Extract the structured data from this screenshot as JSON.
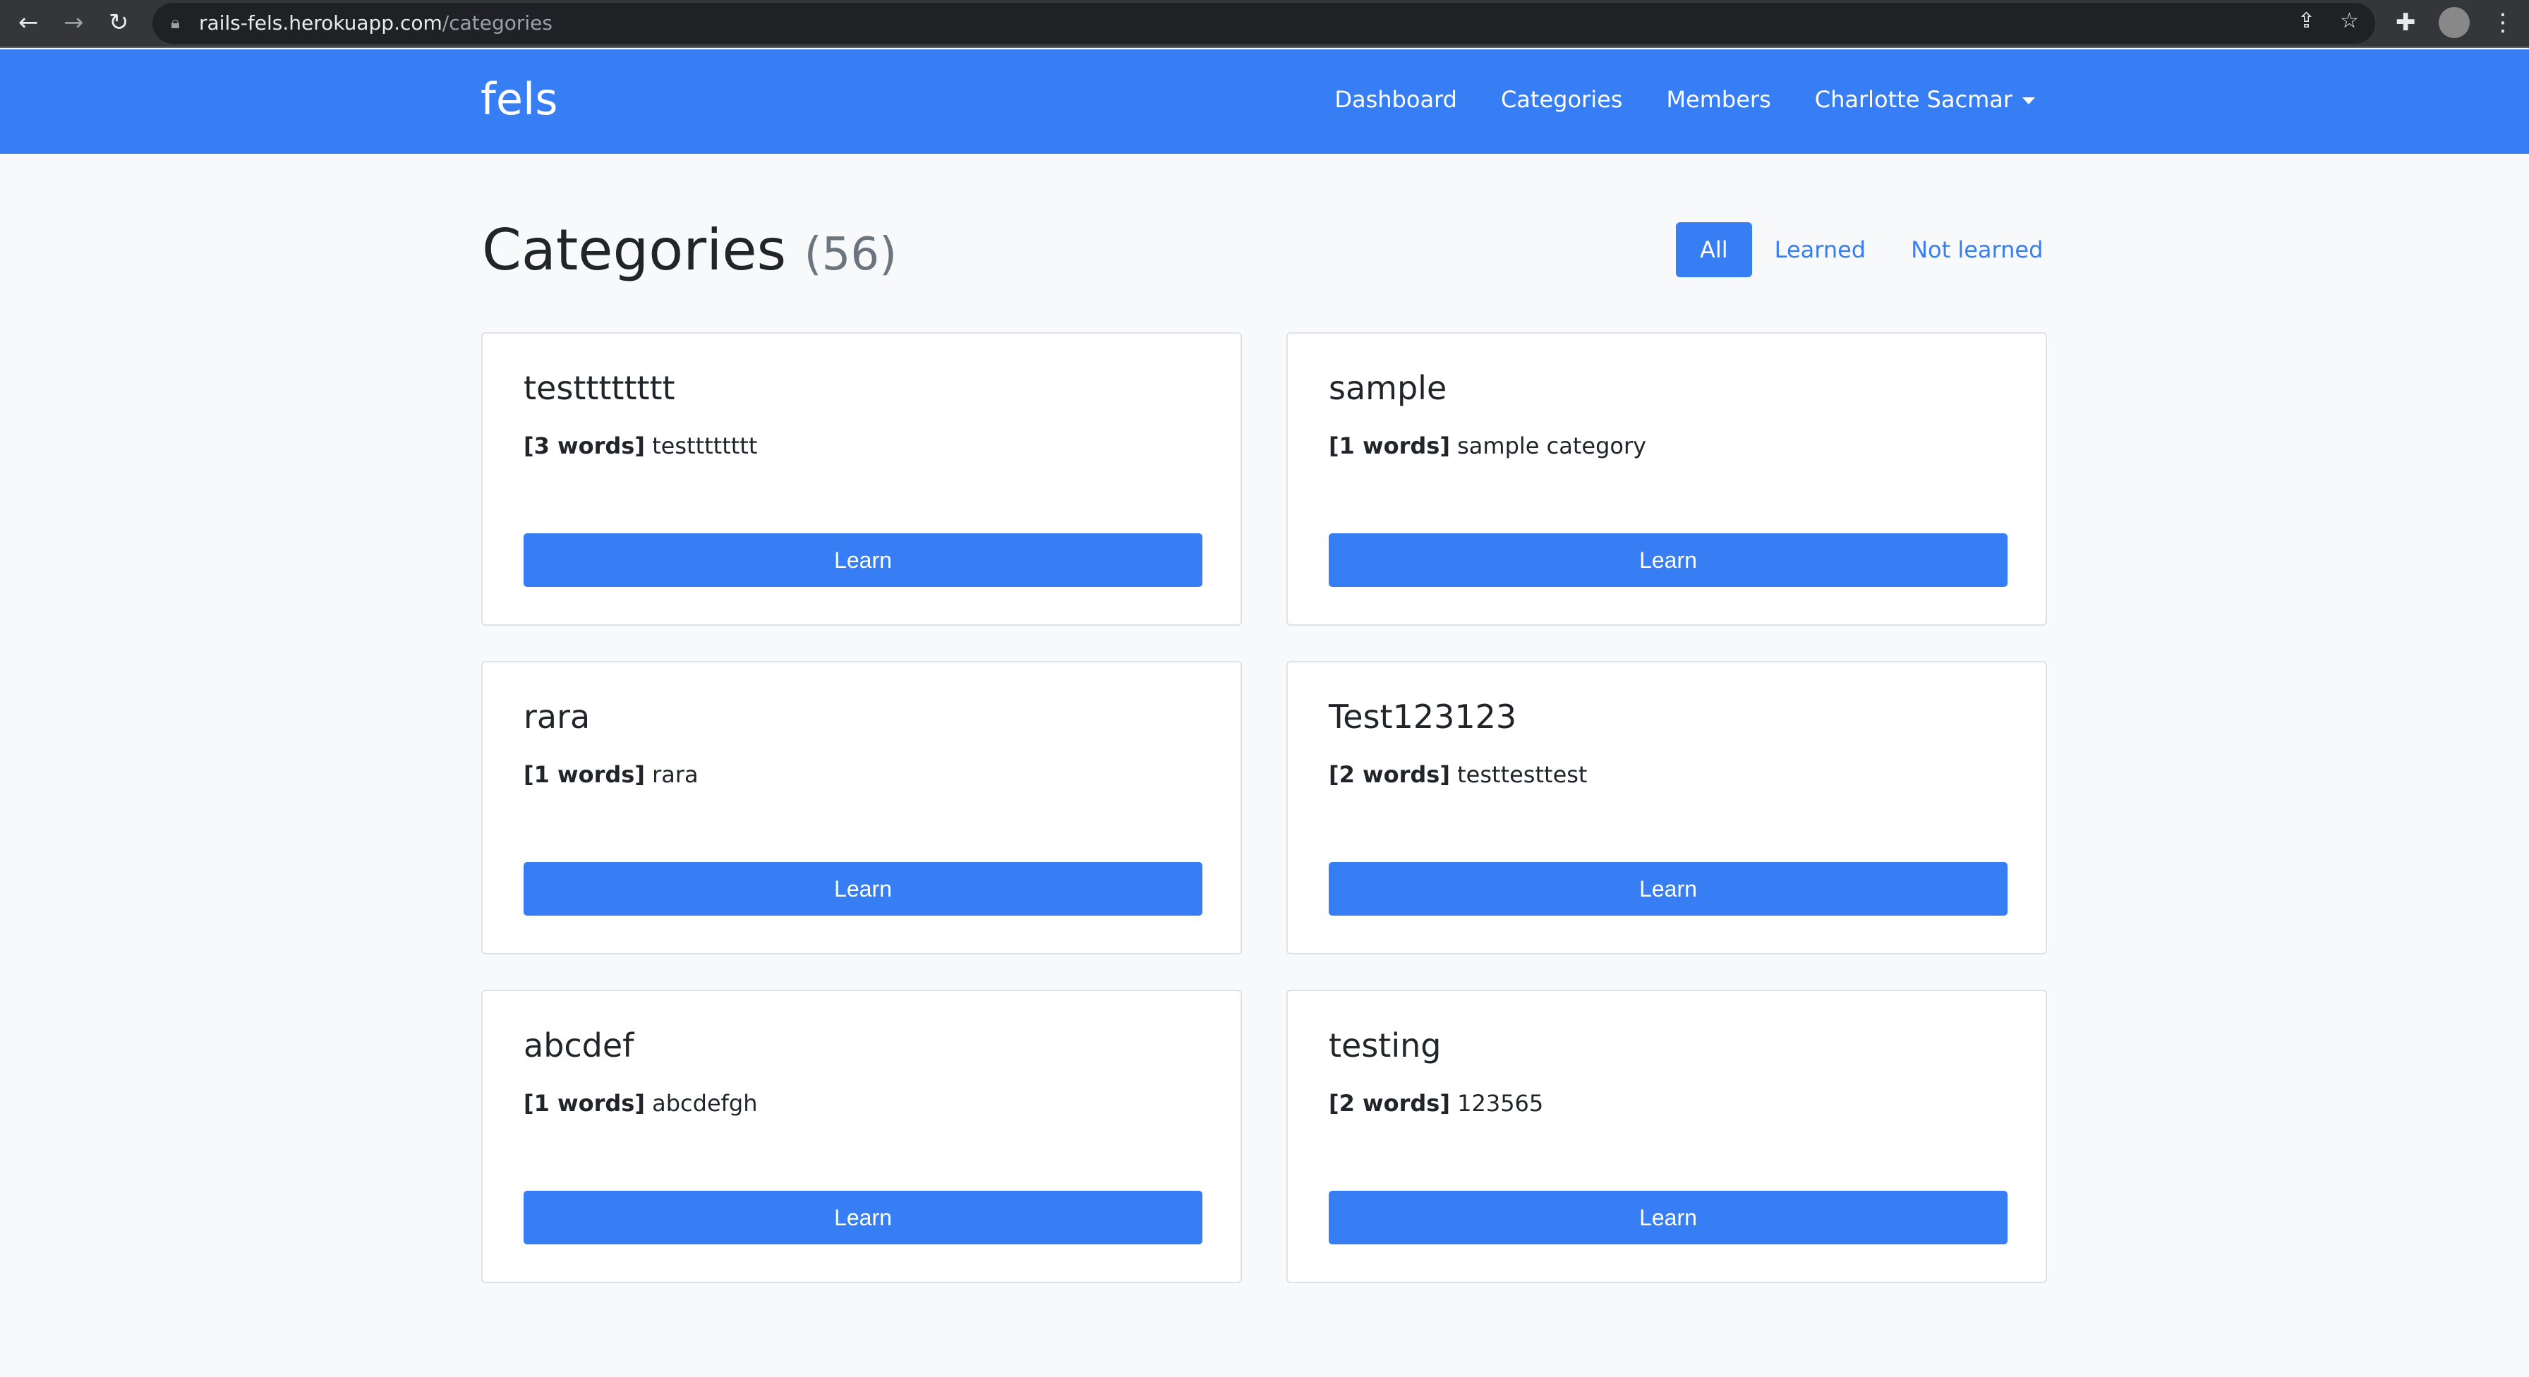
{
  "browser": {
    "url_host": "rails-fels.herokuapp.com",
    "url_path": "/categories"
  },
  "nav": {
    "brand": "fels",
    "links": [
      "Dashboard",
      "Categories",
      "Members"
    ],
    "user": "Charlotte Sacmar"
  },
  "page": {
    "title": "Categories",
    "count": "(56)"
  },
  "filters": [
    "All",
    "Learned",
    "Not learned"
  ],
  "categories": [
    {
      "name": "testttttttt",
      "words": "[3 words]",
      "desc": "testttttttt",
      "button": "Learn"
    },
    {
      "name": "sample",
      "words": "[1 words]",
      "desc": "sample category",
      "button": "Learn"
    },
    {
      "name": "rara",
      "words": "[1 words]",
      "desc": "rara",
      "button": "Learn"
    },
    {
      "name": "Test123123",
      "words": "[2 words]",
      "desc": "testtesttest",
      "button": "Learn"
    },
    {
      "name": "abcdef",
      "words": "[1 words]",
      "desc": "abcdefgh",
      "button": "Learn"
    },
    {
      "name": "testing",
      "words": "[2 words]",
      "desc": "123565",
      "button": "Learn"
    }
  ],
  "colors": {
    "primary": "#377ef4"
  }
}
